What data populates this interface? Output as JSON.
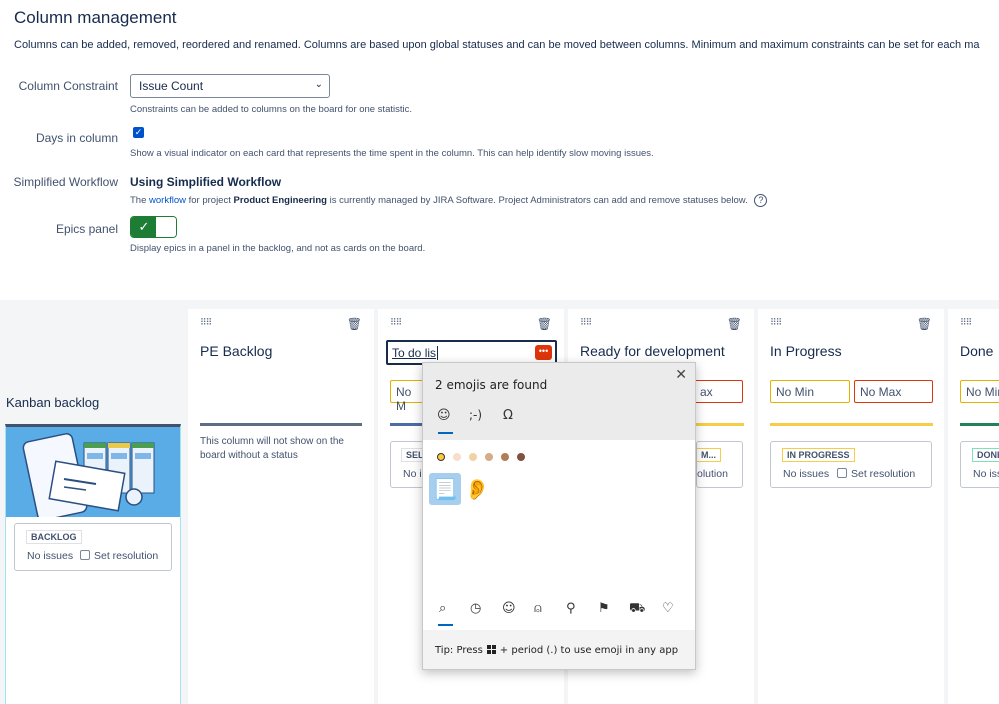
{
  "page": {
    "title": "Column management",
    "description": "Columns can be added, removed, reordered and renamed. Columns are based upon global statuses and can be moved between columns. Minimum and maximum constraints can be set for each ma"
  },
  "settings": {
    "constraint": {
      "label": "Column Constraint",
      "value": "Issue Count",
      "help": "Constraints can be added to columns on the board for one statistic."
    },
    "days": {
      "label": "Days in column",
      "checked": true,
      "help": "Show a visual indicator on each card that represents the time spent in the column. This can help identify slow moving issues."
    },
    "workflow": {
      "label": "Simplified Workflow",
      "value": "Using Simplified Workflow",
      "help_prefix": "The ",
      "help_link": "workflow",
      "help_mid": " for project ",
      "help_project": "Product Engineering",
      "help_suffix": " is currently managed by JIRA Software. Project Administrators can add and remove statuses below."
    },
    "epics": {
      "label": "Epics panel",
      "enabled": true,
      "help": "Display epics in a panel in the backlog, and not as cards on the board."
    }
  },
  "board": {
    "backlog": {
      "title": "Kanban backlog",
      "status": "BACKLOG",
      "no_issues": "No issues",
      "set_resolution": "Set resolution"
    },
    "columns": [
      {
        "name": "PE Backlog",
        "note": "This column will not show on the board without a status"
      },
      {
        "name": "To do list",
        "edit_value": "To do lis",
        "min": "No M",
        "status": "SEL",
        "no_issues": "No is"
      },
      {
        "name": "Ready for development",
        "max": "ax",
        "status": "M...",
        "resolution_text": "olution"
      },
      {
        "name": "In Progress",
        "min": "No Min",
        "max": "No Max",
        "status": "IN PROGRESS",
        "no_issues": "No issues",
        "set_resolution": "Set resolution"
      },
      {
        "name": "Done",
        "min": "No Mir",
        "status": "DONI",
        "no_issues": "No iss"
      }
    ],
    "colors": {
      "grey": "#5e6c84",
      "blue": "#4c6ca6",
      "yellow": "#f5cd47",
      "green": "#1f845a"
    }
  },
  "emoji_panel": {
    "title": "2 emojis are found",
    "tabs": [
      "☺",
      ";-)",
      "Ω"
    ],
    "results": [
      "📃",
      "👂"
    ],
    "categories": [
      "search-icon",
      "clock-icon",
      "smiley-icon",
      "people-icon",
      "pin-icon",
      "flag-icon",
      "car-icon",
      "heart-icon"
    ],
    "tip_prefix": "Tip: Press",
    "tip_suffix": "+ period (.) to use emoji in any app",
    "skin_tones": [
      "#ffc83d",
      "#f7dece",
      "#f3d2a2",
      "#d5ab88",
      "#af7e57",
      "#7c533e"
    ]
  }
}
